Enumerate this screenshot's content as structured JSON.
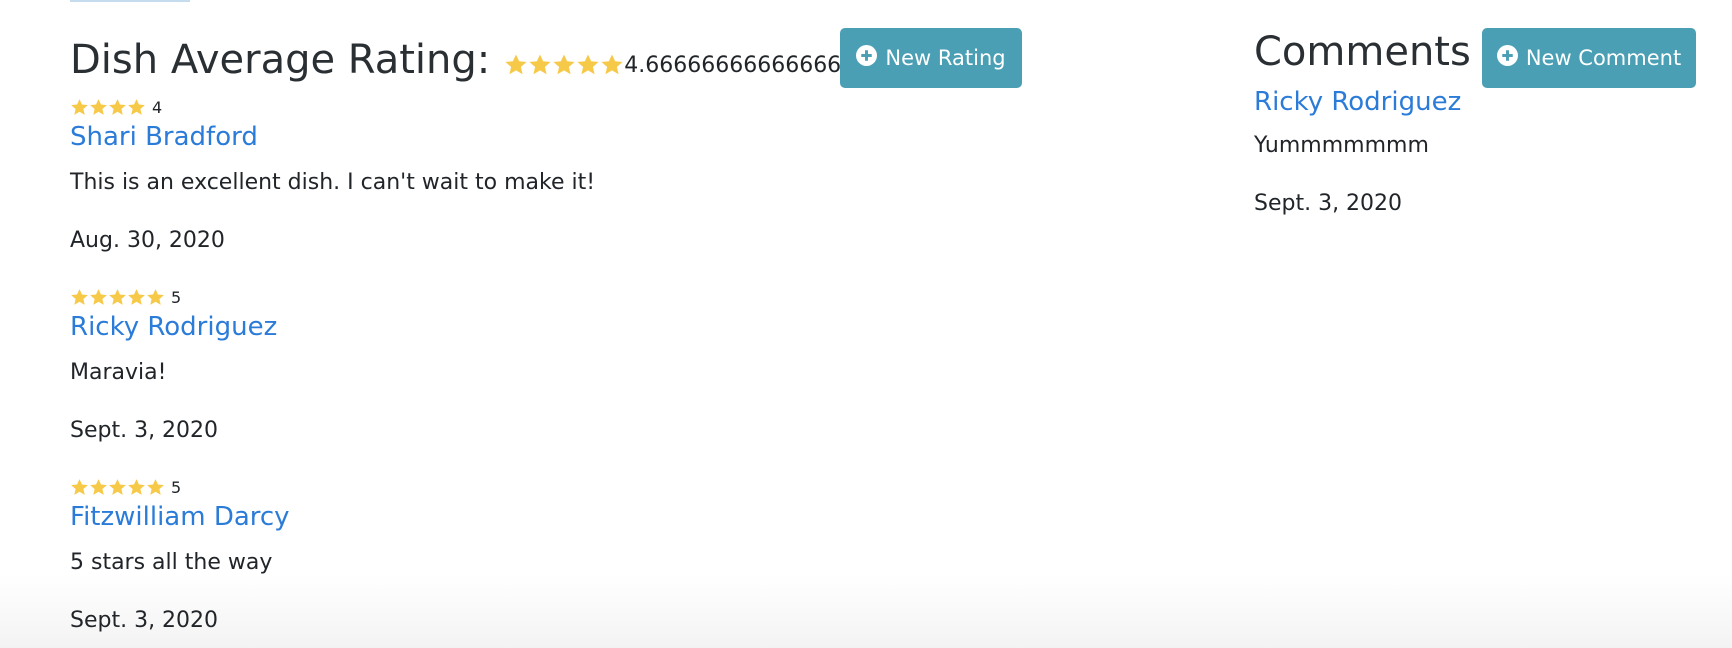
{
  "ratings": {
    "title": "Dish Average Rating:",
    "average_stars": 5,
    "average_value": "4.666666666666667",
    "new_button_label": "New Rating",
    "items": [
      {
        "stars": 4,
        "score": "4",
        "author": "Shari Bradford",
        "text": "This is an excellent dish. I can't wait to make it!",
        "date": "Aug. 30, 2020"
      },
      {
        "stars": 5,
        "score": "5",
        "author": "Ricky Rodriguez",
        "text": "Maravia!",
        "date": "Sept. 3, 2020"
      },
      {
        "stars": 5,
        "score": "5",
        "author": "Fitzwilliam Darcy",
        "text": "5 stars all the way",
        "date": "Sept. 3, 2020"
      }
    ]
  },
  "comments": {
    "title": "Comments",
    "new_button_label": "New Comment",
    "items": [
      {
        "author": "Ricky Rodriguez",
        "text": "Yummmmmmm",
        "date": "Sept. 3, 2020"
      }
    ]
  },
  "colors": {
    "button_bg": "#4a9fb4",
    "link": "#2b7bd8",
    "star": "#f7c948"
  },
  "icons": {
    "star": "star-icon",
    "add": "plus-circle-icon"
  }
}
